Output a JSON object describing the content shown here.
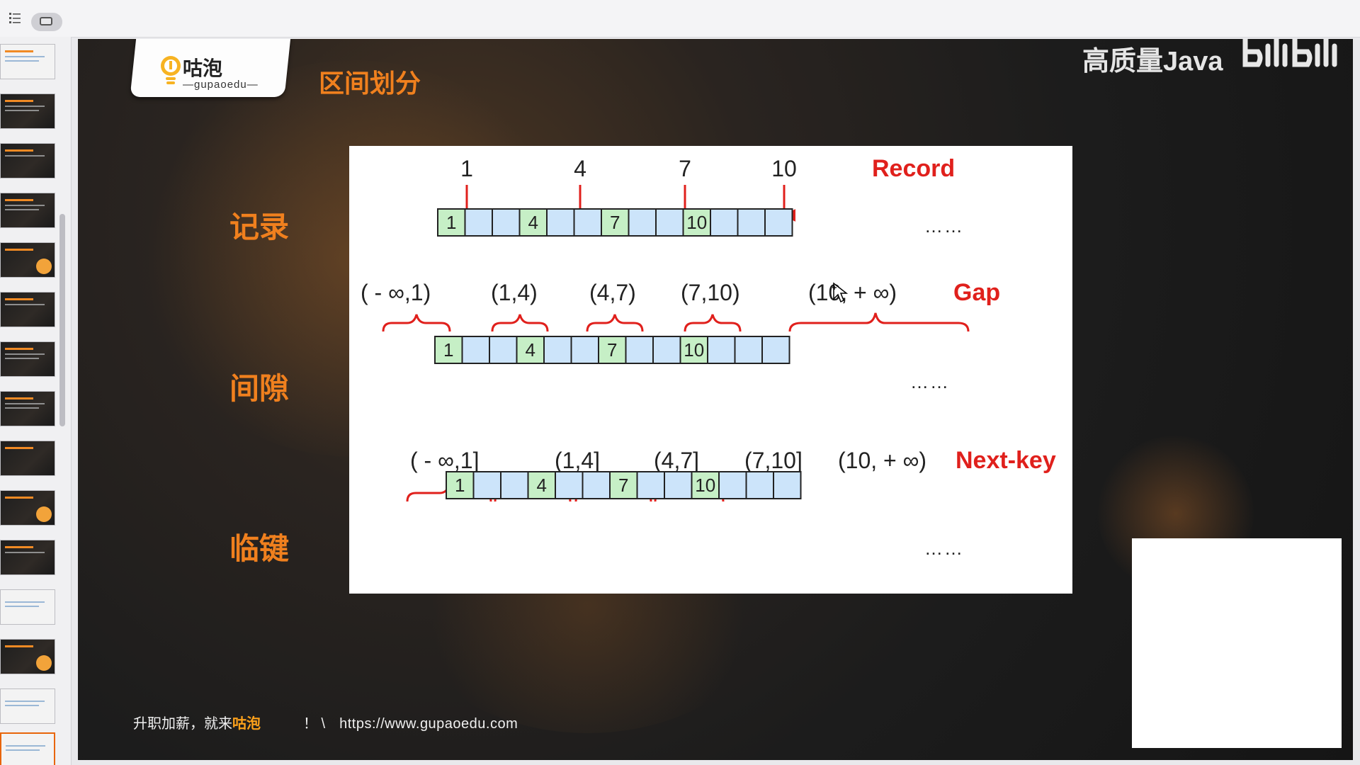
{
  "app": {
    "rail_toggle_icon": "slide-view-icon",
    "list_icon": "list-icon"
  },
  "thumbnails": {
    "count": 15,
    "active_index": 14
  },
  "slide": {
    "logo": {
      "cn": "咕泡",
      "en": "—gupaoedu—"
    },
    "title": "区间划分",
    "watermark": "高质量Java",
    "rows": [
      {
        "label": "记录"
      },
      {
        "label": "间隙"
      },
      {
        "label": "临键"
      }
    ],
    "record": {
      "tag": "Record",
      "keys": [
        "1",
        "4",
        "7",
        "10"
      ],
      "cells": [
        "1",
        "",
        "",
        "4",
        "",
        "",
        "7",
        "",
        "",
        "10",
        "",
        "",
        ""
      ],
      "ellipsis": "……"
    },
    "gap": {
      "tag": "Gap",
      "intervals": [
        "( - ∞,1)",
        "(1,4)",
        "(4,7)",
        "(7,10)",
        "(10,  + ∞)"
      ],
      "cells": [
        "1",
        "",
        "",
        "4",
        "",
        "",
        "7",
        "",
        "",
        "10",
        "",
        "",
        ""
      ],
      "ellipsis": "……"
    },
    "nextkey": {
      "tag": "Next-key",
      "intervals": [
        "( - ∞,1]",
        "(1,4]",
        "(4,7]",
        "(7,10]",
        "(10,  + ∞)"
      ],
      "cells": [
        "1",
        "",
        "",
        "4",
        "",
        "",
        "7",
        "",
        "",
        "10",
        "",
        "",
        ""
      ],
      "ellipsis": "……"
    },
    "footer": {
      "slogan": "升职加薪，就来",
      "brand": "咕泡",
      "sep": "！ \\",
      "url": "https://www.gupaoedu.com"
    }
  },
  "colors": {
    "accent": "#f0801e",
    "red": "#e0201c",
    "cell_key": "#c6efc6",
    "cell_empty": "#cce4fa"
  }
}
